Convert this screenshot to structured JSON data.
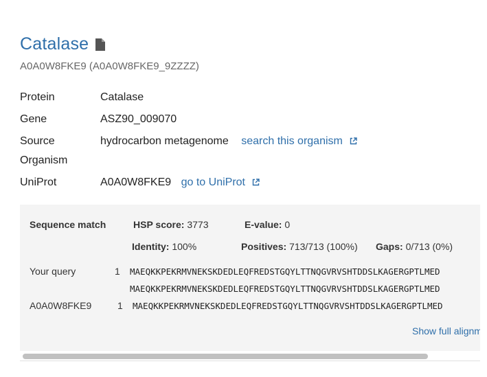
{
  "header": {
    "title": "Catalase",
    "subtitle": "A0A0W8FKE9 (A0A0W8FKE9_9ZZZZ)",
    "title_icon": "document-icon"
  },
  "fields": {
    "protein_label": "Protein",
    "protein_value": "Catalase",
    "gene_label": "Gene",
    "gene_value": "ASZ90_009070",
    "source_label_line1": "Source",
    "source_label_line2": "Organism",
    "source_value": "hydrocarbon metagenome",
    "source_link": "search this organism",
    "uniprot_label": "UniProt",
    "uniprot_value": "A0A0W8FKE9",
    "uniprot_link": "go to UniProt",
    "external_icon": "external-link-icon"
  },
  "match": {
    "section_label": "Sequence match",
    "hsp_label": "HSP score:",
    "hsp_value": "3773",
    "evalue_label": "E-value:",
    "evalue_value": "0",
    "identity_label": "Identity:",
    "identity_value": "100%",
    "positives_label": "Positives:",
    "positives_value": "713/713 (100%)",
    "gaps_label": "Gaps:",
    "gaps_value": "0/713 (0%)",
    "query_label": "Your query",
    "query_start": "1",
    "query_seq": "MAEQKKPEKRMVNEKSKDEDLEQFREDSTGQYLTTNQGVRVSHTDDSLKAGERGPTLMED",
    "midline_seq": "MAEQKKPEKRMVNEKSKDEDLEQFREDSTGQYLTTNQGVRVSHTDDSLKAGERGPTLMED",
    "subject_label": "A0A0W8FKE9",
    "subject_start": "1",
    "subject_seq": "MAEQKKPEKRMVNEKSKDEDLEQFREDSTGQYLTTNQGVRVSHTDDSLKAGERGPTLMED",
    "show_more": "Show full alignm"
  },
  "colors": {
    "link": "#2f6faa",
    "panel_bg": "#f4f4f4"
  }
}
